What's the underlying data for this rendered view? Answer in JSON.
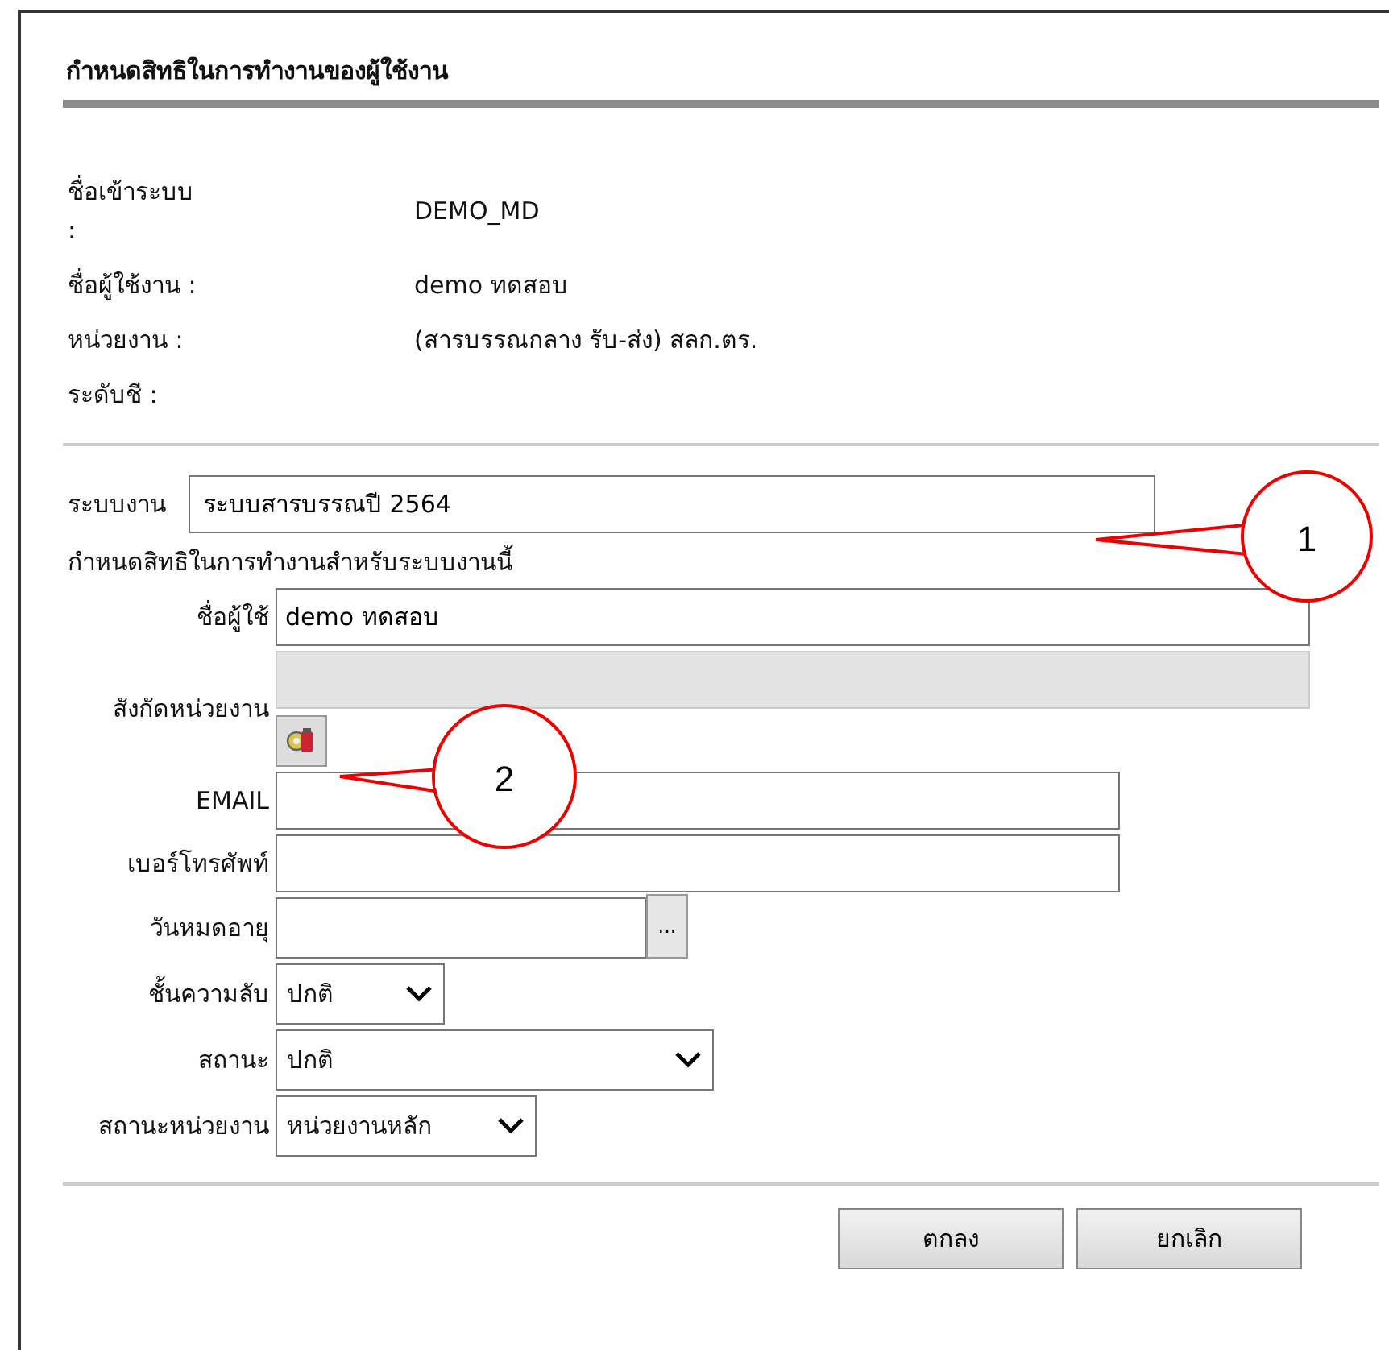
{
  "title": "กำหนดสิทธิในการทำงานของผู้ใช้งาน",
  "info": [
    {
      "label": "ชื่อเข้าระบบ :",
      "value": "DEMO_MD"
    },
    {
      "label": "ชื่อผู้ใช้งาน :",
      "value": "demo ทดสอบ"
    },
    {
      "label": "หน่วยงาน :",
      "value": "(สารบรรณกลาง รับ-ส่ง) สลก.ตร."
    },
    {
      "label": "ระดับชี :"
    }
  ],
  "system": {
    "label": "ระบบงาน",
    "value": "ระบบสารบรรณปี 2564"
  },
  "section_heading": "กำหนดสิทธิในการทำงานสำหรับระบบงานนี้",
  "form": [
    {
      "kind": "text",
      "label": "ชื่อผู้ใช้",
      "value": "demo ทดสอบ"
    },
    {
      "kind": "picker",
      "label": "สังกัดหน่วยงาน"
    },
    {
      "kind": "text",
      "label": "EMAIL"
    },
    {
      "kind": "text",
      "label": "เบอร์โทรศัพท์"
    },
    {
      "kind": "date",
      "label": "วันหมดอายุ",
      "button_label": "..."
    },
    {
      "kind": "select",
      "label": "ชั้นความลับ",
      "value": "ปกติ"
    },
    {
      "kind": "select",
      "label": "สถานะ",
      "value": "ปกติ"
    },
    {
      "kind": "select",
      "label": "สถานะหน่วยงาน",
      "value": "หน่วยงานหลัก"
    }
  ],
  "buttons": [
    "ตกลง",
    "ยกเลิก"
  ],
  "callouts": [
    {
      "number": "1"
    },
    {
      "number": "2"
    }
  ]
}
